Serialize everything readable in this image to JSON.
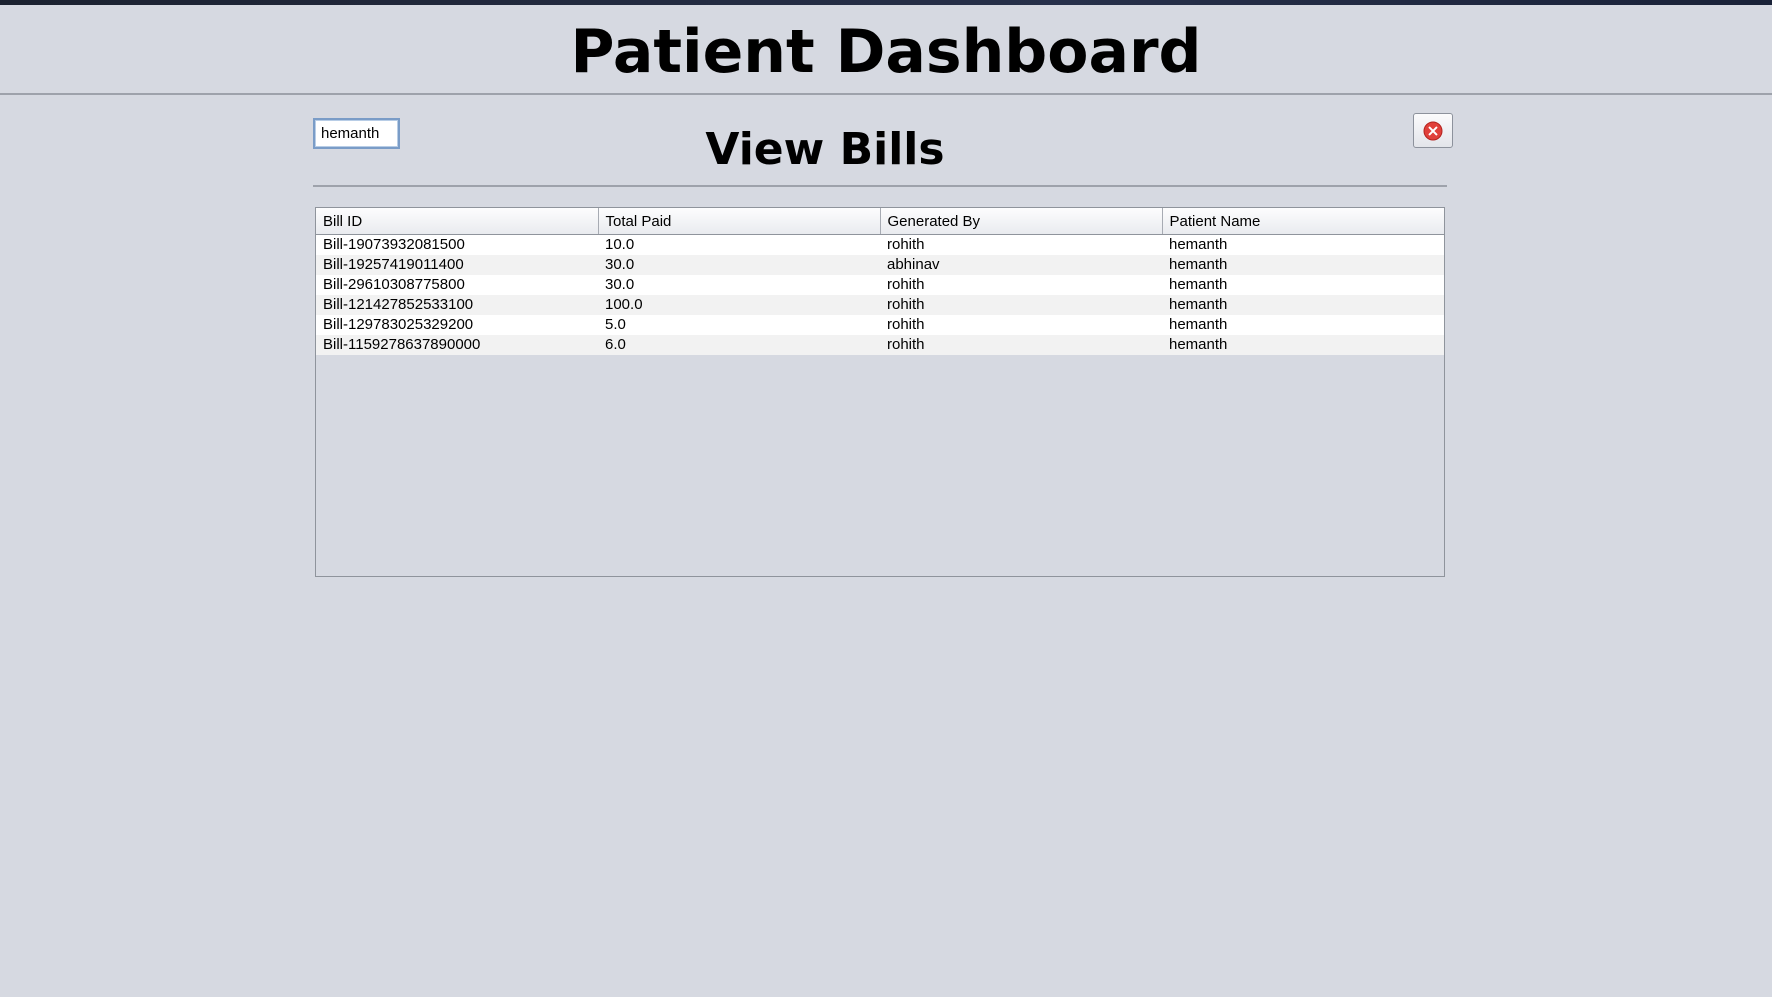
{
  "header": {
    "title": "Patient Dashboard"
  },
  "search": {
    "value": "hemanth"
  },
  "section": {
    "title": "View Bills"
  },
  "toolbar": {
    "close_icon": "close-circle-icon",
    "close_icon_color": "#e0403a"
  },
  "table": {
    "columns": [
      "Bill ID",
      "Total Paid",
      "Generated By",
      "Patient Name"
    ],
    "rows": [
      [
        "Bill-19073932081500",
        "10.0",
        "rohith",
        "hemanth"
      ],
      [
        "Bill-19257419011400",
        "30.0",
        "abhinav",
        "hemanth"
      ],
      [
        "Bill-29610308775800",
        "30.0",
        "rohith",
        "hemanth"
      ],
      [
        "Bill-121427852533100",
        "100.0",
        "rohith",
        "hemanth"
      ],
      [
        "Bill-129783025329200",
        "5.0",
        "rohith",
        "hemanth"
      ],
      [
        "Bill-1159278637890000",
        "6.0",
        "rohith",
        "hemanth"
      ]
    ]
  },
  "colors": {
    "background": "#d6d9e1",
    "row_alt": "#f2f2f2"
  }
}
